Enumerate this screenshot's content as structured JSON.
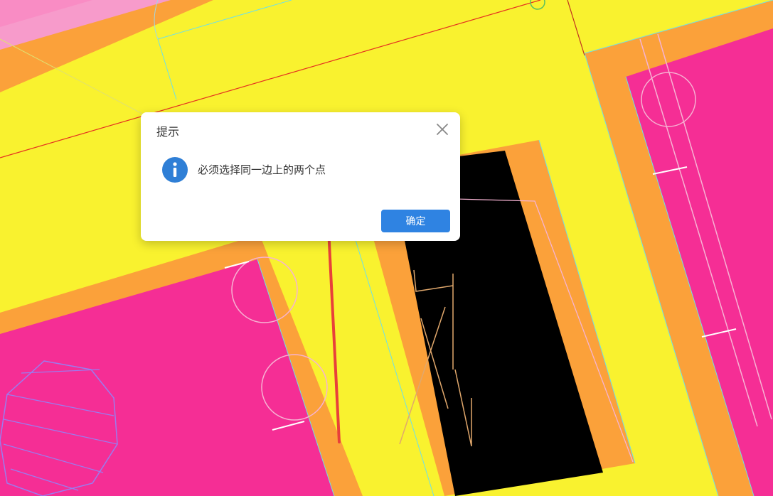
{
  "dialog": {
    "title": "提示",
    "message": "必须选择同一边上的两个点",
    "ok_label": "确定"
  },
  "icons": {
    "close": "close-icon",
    "info": "info-icon",
    "arrow": "annotation-arrow"
  },
  "colors": {
    "canvas_yellow": "#f9f22f",
    "canvas_pink": "#f52e95",
    "canvas_orange": "#fba13a",
    "canvas_black": "#000000",
    "info_blue": "#2f7fd6",
    "button_blue": "#2f83e2",
    "arrow_red": "#e8403a"
  }
}
